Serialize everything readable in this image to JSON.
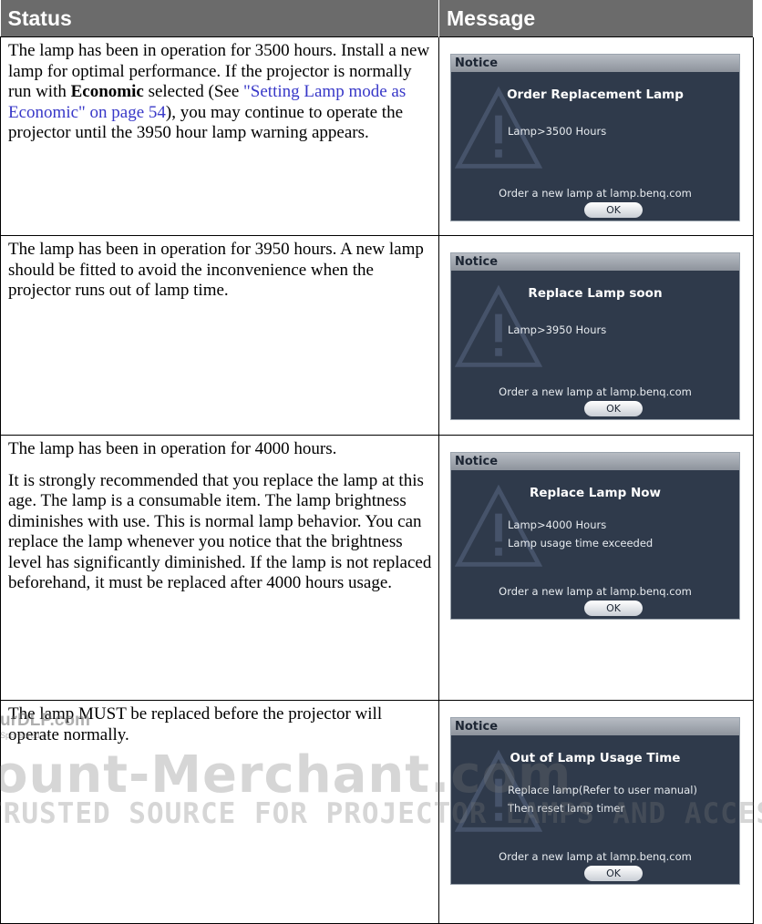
{
  "table": {
    "headers": {
      "status": "Status",
      "message": "Message"
    },
    "rows": [
      {
        "status_parts": {
          "text1": "The lamp has been in operation for 3500 hours. Install a new lamp for optimal performance. If the projector is normally run with ",
          "bold": "Economic",
          "text2": " selected (See ",
          "link": "\"Setting Lamp mode as Economic\" on page 54",
          "text3": "), you may continue to operate the projector until the 3950 hour lamp warning appears."
        },
        "osd": {
          "title": "Notice",
          "heading": "Order Replacement Lamp",
          "lines": [
            "Lamp>3500 Hours"
          ],
          "order_text": "Order a new lamp at lamp.benq.com",
          "ok_label": "OK"
        }
      },
      {
        "status_paragraphs": [
          "The lamp has been in operation for 3950 hours. A new lamp should be fitted to avoid the inconvenience when the projector runs out of lamp time."
        ],
        "osd": {
          "title": "Notice",
          "heading": "Replace Lamp soon",
          "lines": [
            "Lamp>3950 Hours"
          ],
          "order_text": "Order a new lamp at lamp.benq.com",
          "ok_label": "OK"
        }
      },
      {
        "status_paragraphs": [
          "The lamp has been in operation for 4000 hours.",
          "It is strongly recommended that you replace the lamp at this age. The lamp is a consumable item. The lamp brightness diminishes with use. This is normal lamp behavior. You can replace the lamp whenever you notice that the brightness level has significantly diminished. If the lamp is not replaced beforehand, it must be replaced after 4000 hours usage."
        ],
        "osd": {
          "title": "Notice",
          "heading": "Replace Lamp Now",
          "lines": [
            "Lamp>4000 Hours",
            "Lamp usage time exceeded"
          ],
          "order_text": "Order a new lamp at lamp.benq.com",
          "ok_label": "OK"
        }
      },
      {
        "status_paragraphs": [
          "The lamp MUST be replaced before the projector will operate normally."
        ],
        "osd": {
          "title": "Notice",
          "heading": "Out of Lamp Usage Time",
          "lines": [
            "Replace lamp(Refer to user manual)",
            "Then reset lamp timer"
          ],
          "order_text": "Order a new lamp at lamp.benq.com",
          "ok_label": "OK"
        }
      }
    ]
  },
  "watermark": {
    "site": "urDLP.com",
    "sponsor": "Sponsored by",
    "brand": "ount-Merchant.com",
    "tagline": "TRUSTED SOURCE FOR PROJECTOR LAMPS AND ACCESSORIES"
  },
  "colors": {
    "header_bg": "#6b6b6b",
    "osd_bg": "#2f3a4b",
    "link": "#3838c8"
  }
}
